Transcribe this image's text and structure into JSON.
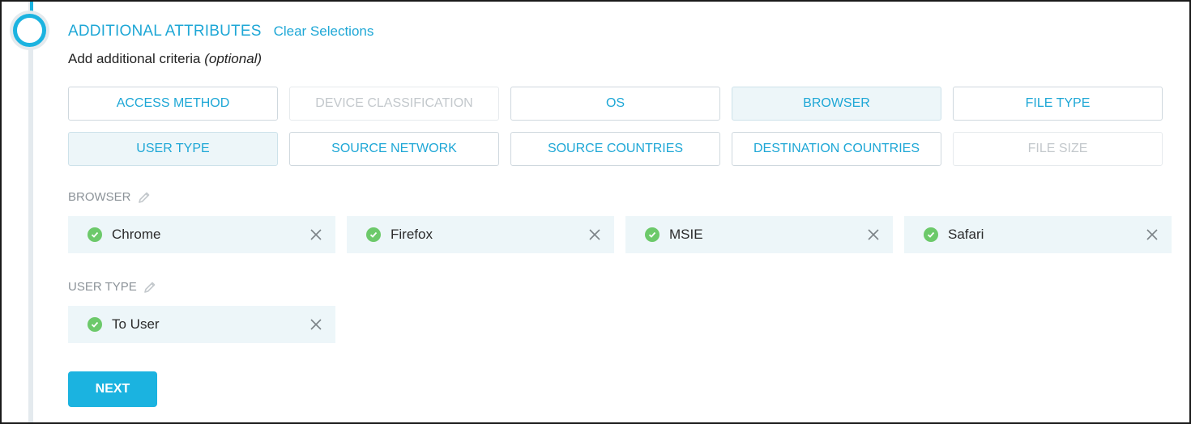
{
  "header": {
    "title": "ADDITIONAL ATTRIBUTES",
    "clear_link": "Clear Selections",
    "subtitle_prefix": "Add additional criteria",
    "subtitle_optional": "(optional)"
  },
  "attributes": {
    "row1": [
      {
        "label": "ACCESS METHOD",
        "state": "normal"
      },
      {
        "label": "DEVICE CLASSIFICATION",
        "state": "disabled"
      },
      {
        "label": "OS",
        "state": "normal"
      },
      {
        "label": "BROWSER",
        "state": "selected"
      },
      {
        "label": "FILE TYPE",
        "state": "normal"
      }
    ],
    "row2": [
      {
        "label": "USER TYPE",
        "state": "selected"
      },
      {
        "label": "SOURCE NETWORK",
        "state": "normal"
      },
      {
        "label": "SOURCE COUNTRIES",
        "state": "normal"
      },
      {
        "label": "DESTINATION COUNTRIES",
        "state": "normal"
      },
      {
        "label": "FILE SIZE",
        "state": "disabled"
      }
    ]
  },
  "sections": {
    "browser": {
      "label": "BROWSER",
      "chips": [
        "Chrome",
        "Firefox",
        "MSIE",
        "Safari"
      ]
    },
    "user_type": {
      "label": "USER TYPE",
      "chips": [
        "To User"
      ]
    }
  },
  "actions": {
    "next_label": "NEXT"
  },
  "colors": {
    "accent": "#1bb3e0",
    "check": "#6cc96a",
    "chip_bg": "#edf6f9"
  }
}
